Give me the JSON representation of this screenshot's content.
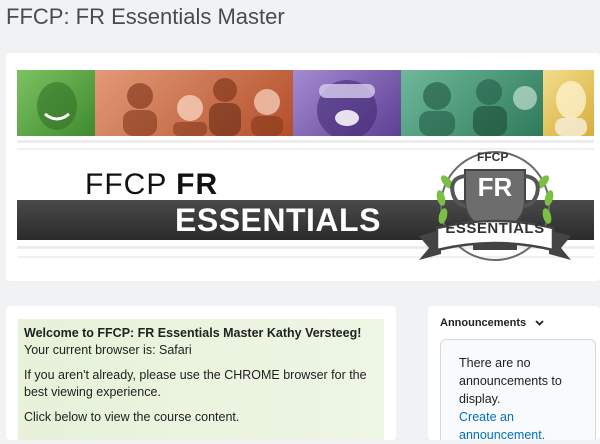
{
  "page": {
    "title": "FFCP: FR Essentials Master"
  },
  "banner": {
    "headline_light": "FFCP ",
    "headline_bold": "FR",
    "subtitle": "ESSENTIALS",
    "emblem": {
      "top_text": "FFCP",
      "shield_text": "FR",
      "ribbon_text": "ESSENTIALS"
    },
    "strip_colors": [
      "#5aa846",
      "#c7633a",
      "#7b5aa8",
      "#3f8e6e",
      "#e3bf55"
    ]
  },
  "welcome": {
    "greeting_bold": "Welcome to FFCP: FR Essentials Master Kathy Versteeg!",
    "browser_text": " Your current browser is: Safari",
    "chrome_notice": "If you aren't already, please use the CHROME browser for the best viewing experience.",
    "instruction": "Click below to view the course content."
  },
  "announcements": {
    "header": "Announcements",
    "empty_text": "There are no announcements to display.",
    "create_link": "Create an announcement."
  },
  "colors": {
    "link": "#006fbf",
    "welcome_bg": "#e7f2d9",
    "page_bg": "#f1f2f4"
  }
}
